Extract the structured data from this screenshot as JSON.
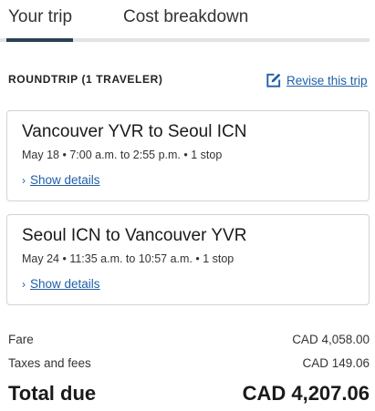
{
  "tabs": [
    {
      "label": "Your trip",
      "active": true
    },
    {
      "label": "Cost breakdown",
      "active": false
    }
  ],
  "colors": {
    "accent": "#1e5fa8",
    "active_tab_bar": "#2a3f52"
  },
  "section": {
    "title": "ROUNDTRIP (1 TRAVELER)",
    "revise_label": "Revise this trip",
    "revise_icon": "edit-icon"
  },
  "flights": [
    {
      "title": "Vancouver YVR to Seoul ICN",
      "summary": "May 18 • 7:00 a.m. to 2:55 p.m. • 1 stop",
      "details_label": "Show details"
    },
    {
      "title": "Seoul ICN to Vancouver YVR",
      "summary": "May 24 • 11:35 a.m. to 10:57 a.m. • 1 stop",
      "details_label": "Show details"
    }
  ],
  "costs": {
    "fare_label": "Fare",
    "fare_value": "CAD 4,058.00",
    "taxes_label": "Taxes and fees",
    "taxes_value": "CAD 149.06",
    "total_label": "Total due",
    "total_value": "CAD 4,207.06"
  }
}
